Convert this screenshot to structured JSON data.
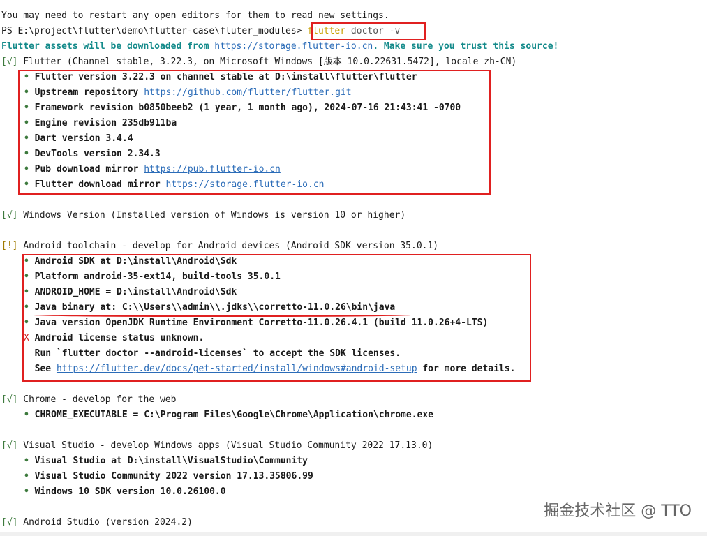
{
  "terminal": {
    "restart_note": "You may need to restart any open editors for them to read new settings.",
    "prompt": "PS E:\\project\\flutter\\demo\\flutter-case\\fluter_modules> ",
    "command": "flutter",
    "command_args": " doctor -v",
    "mirror_notice_prefix": "Flutter assets will be downloaded from ",
    "mirror_notice_link": "https://storage.flutter-io.cn",
    "mirror_notice_suffix": ". Make sure you trust this source!",
    "sections": {
      "flutter": {
        "status": "[√]",
        "header": " Flutter (Channel stable, 3.22.3, on Microsoft Windows [版本 10.0.22631.5472], locale zh-CN)",
        "details": [
          {
            "text": "Flutter version 3.22.3 on channel stable at D:\\install\\flutter\\flutter"
          },
          {
            "text": "Upstream repository ",
            "link": "https://github.com/flutter/flutter.git"
          },
          {
            "text": "Framework revision b0850beeb2 (1 year, 1 month ago), 2024-07-16 21:43:41 -0700"
          },
          {
            "text": "Engine revision 235db911ba"
          },
          {
            "text": "Dart version 3.4.4"
          },
          {
            "text": "DevTools version 2.34.3"
          },
          {
            "text": "Pub download mirror ",
            "link": "https://pub.flutter-io.cn"
          },
          {
            "text": "Flutter download mirror ",
            "link": "https://storage.flutter-io.cn"
          }
        ]
      },
      "windows": {
        "status": "[√]",
        "header": " Windows Version (Installed version of Windows is version 10 or higher)"
      },
      "android": {
        "status": "[!]",
        "header": " Android toolchain - develop for Android devices (Android SDK version 35.0.1)",
        "details": [
          {
            "text": "Android SDK at D:\\install\\Android\\Sdk"
          },
          {
            "text": "Platform android-35-ext14, build-tools 35.0.1"
          },
          {
            "text": "ANDROID_HOME = D:\\install\\Android\\Sdk"
          },
          {
            "text": "Java binary at: C:\\\\Users\\\\admin\\\\.jdks\\\\corretto-11.0.26\\bin\\java"
          },
          {
            "text": "Java version OpenJDK Runtime Environment Corretto-11.0.26.4.1 (build 11.0.26+4-LTS)"
          }
        ],
        "license_mark": "X",
        "license_status": "Android license status unknown.",
        "license_run": "Run `flutter doctor --android-licenses` to accept the SDK licenses.",
        "license_see_prefix": "See ",
        "license_see_link": "https://flutter.dev/docs/get-started/install/windows#android-setup",
        "license_see_suffix": " for more details."
      },
      "chrome": {
        "status": "[√]",
        "header": " Chrome - develop for the web",
        "details": [
          {
            "text": "CHROME_EXECUTABLE = C:\\Program Files\\Google\\Chrome\\Application\\chrome.exe"
          }
        ]
      },
      "visual_studio": {
        "status": "[√]",
        "header": " Visual Studio - develop Windows apps (Visual Studio Community 2022 17.13.0)",
        "details": [
          {
            "text": "Visual Studio at D:\\install\\VisualStudio\\Community"
          },
          {
            "text": "Visual Studio Community 2022 version 17.13.35806.99"
          },
          {
            "text": "Windows 10 SDK version 10.0.26100.0"
          }
        ]
      },
      "android_studio": {
        "status": "[√]",
        "header": " Android Studio (version 2024.2)"
      }
    },
    "bullet": "•"
  },
  "watermark": "掘金技术社区 @ TTO",
  "colors": {
    "highlight_box": "#e02020",
    "ok_status": "#3d7a3d",
    "warn_status": "#a07a00",
    "notice": "#138a8a",
    "link": "#2b6cb8"
  }
}
